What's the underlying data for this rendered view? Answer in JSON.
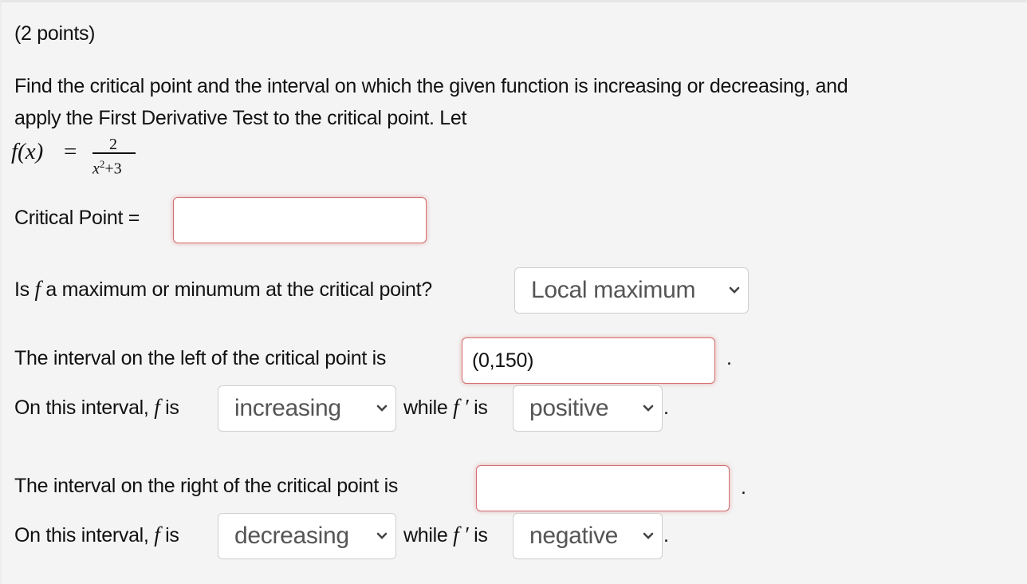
{
  "points_label": "(2 points)",
  "question": {
    "line1": "Find the critical point and the interval on which the given function is increasing or decreasing, and",
    "line2": "apply the First Derivative Test to the critical point. Let",
    "function": {
      "lhs": "f(x)",
      "equals": "=",
      "numerator": "2",
      "denominator_base": "x",
      "denominator_exp": "2",
      "denominator_rest": "+3"
    }
  },
  "critical_point": {
    "label": "Critical Point =",
    "value": ""
  },
  "extremum": {
    "label_prefix": "Is",
    "label_var": "f",
    "label_suffix": "a maximum or minumum at the critical point?",
    "selected": "Local maximum"
  },
  "left_interval": {
    "label": "The interval on the left of the critical point is",
    "value": "(0,150)",
    "period": ".",
    "behavior_prefix": "On this interval,",
    "behavior_var": "f",
    "behavior_is": "is",
    "behavior_selected": "increasing",
    "while": "while",
    "deriv_var": "f ′",
    "deriv_is": "is",
    "deriv_selected": "positive",
    "end_period": "."
  },
  "right_interval": {
    "label": "The interval on the right of the critical point is",
    "value": "",
    "period": ".",
    "behavior_prefix": "On this interval,",
    "behavior_var": "f",
    "behavior_is": "is",
    "behavior_selected": "decreasing",
    "while": "while",
    "deriv_var": "f ′",
    "deriv_is": "is",
    "deriv_selected": "negative",
    "end_period": "."
  },
  "icons": {
    "dropdown": "chevron-down-icon"
  }
}
